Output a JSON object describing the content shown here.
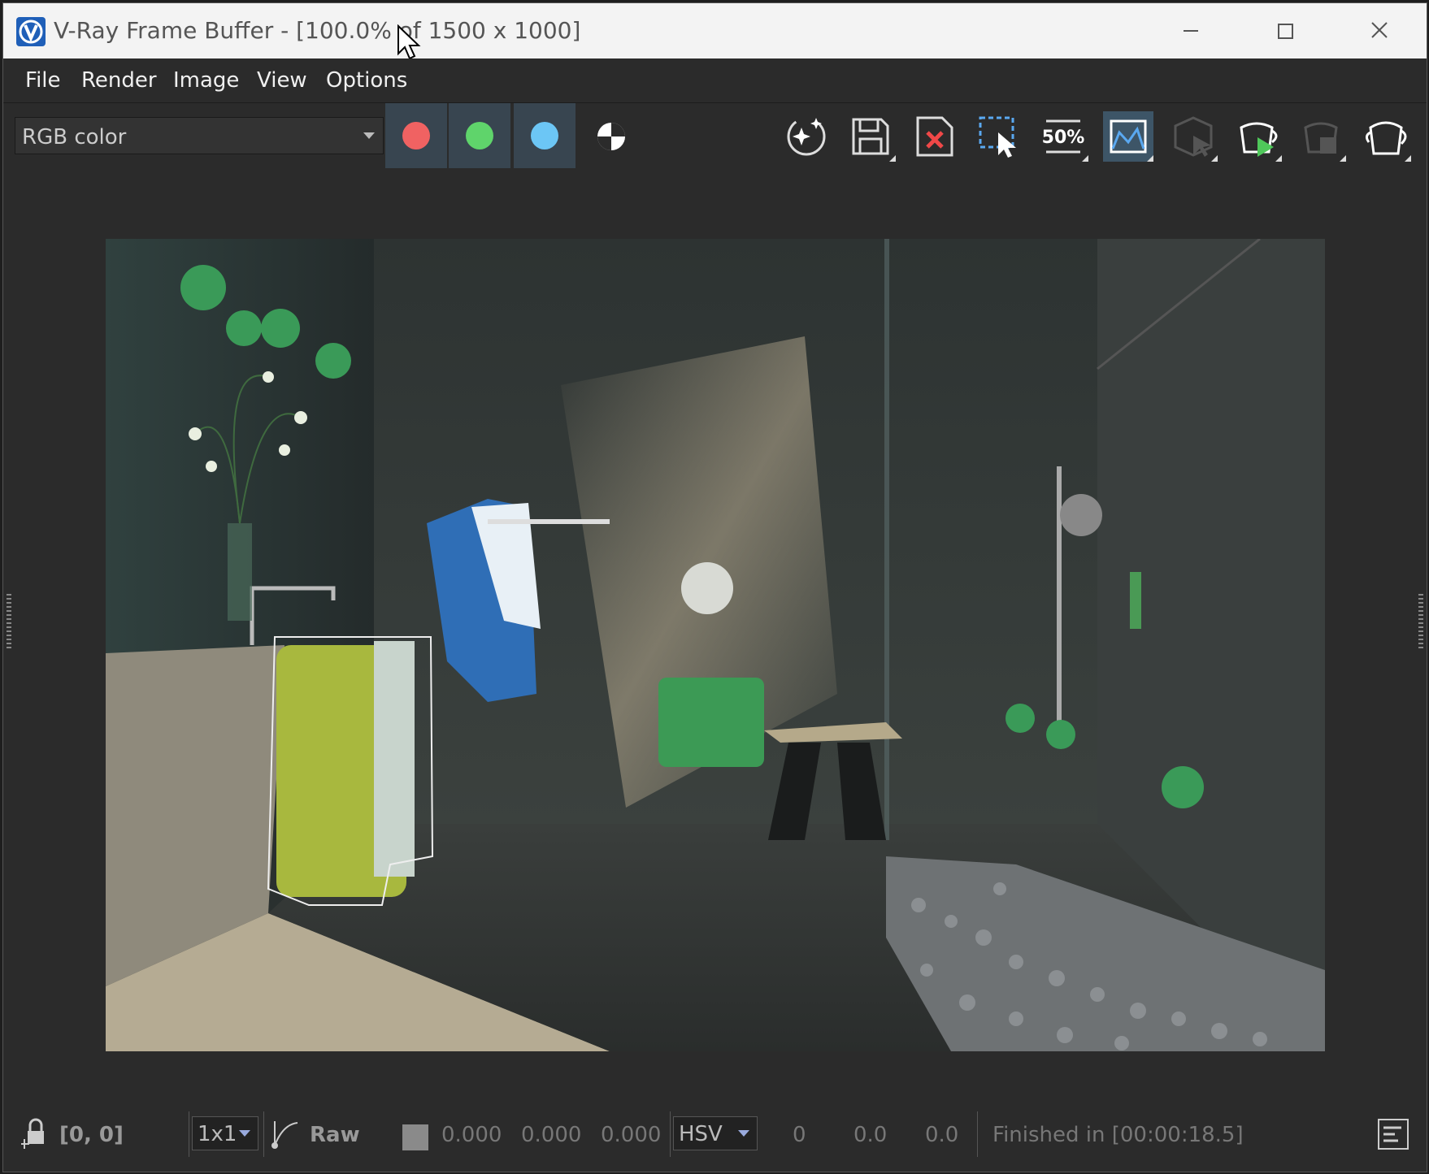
{
  "window": {
    "title": "V-Ray Frame Buffer - [100.0% of 1500 x 1000]",
    "controls": {
      "minimize": "minimize-icon",
      "maximize": "maximize-icon",
      "close": "close-icon"
    }
  },
  "menu": {
    "items": [
      "File",
      "Render",
      "Image",
      "View",
      "Options"
    ]
  },
  "toolbar": {
    "channel_select": {
      "value": "RGB color"
    },
    "channels": [
      {
        "name": "red-channel",
        "color": "#f06262"
      },
      {
        "name": "green-channel",
        "color": "#5fd46b"
      },
      {
        "name": "blue-channel",
        "color": "#6cc6f5"
      }
    ],
    "icons": [
      "monochrome-icon",
      "denoise-sparkle-icon",
      "save-image-icon",
      "clear-image-icon",
      "region-render-icon",
      "zoom-50-icon",
      "compare-history-icon",
      "interactive-render-icon",
      "start-render-icon",
      "stop-render-icon",
      "render-teapot-icon"
    ],
    "zoom_label": "50%"
  },
  "colors": {
    "accent": "#3d5567",
    "channel_bg": "#384550",
    "titlebar": "#f3f3f3",
    "panel": "#2b2b2b"
  },
  "status": {
    "coords": "[0, 0]",
    "sample_size": "1x1",
    "mode": "Raw",
    "r": "0.000",
    "g": "0.000",
    "b": "0.000",
    "color_space": "HSV",
    "h": "0",
    "s": "0.0",
    "v": "0.0",
    "message": "Finished in [00:00:18.5]"
  }
}
